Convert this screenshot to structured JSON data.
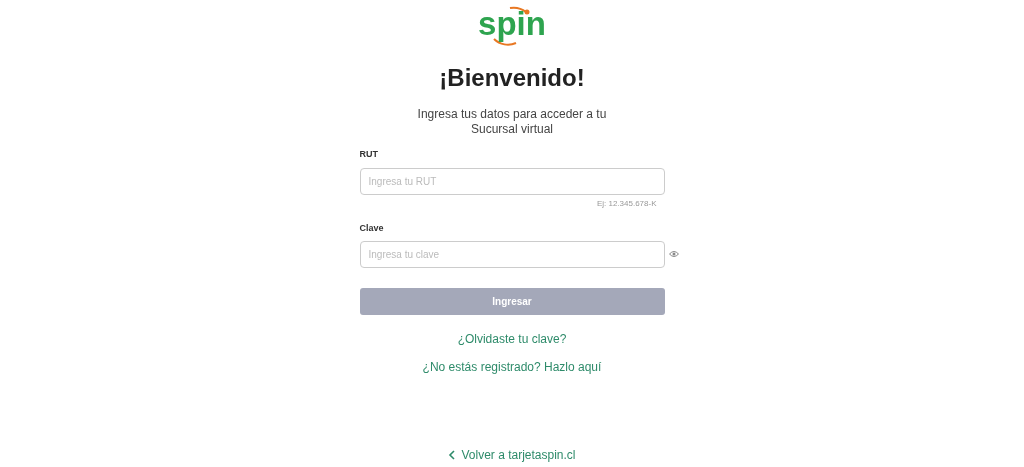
{
  "logo": {
    "text": "spin"
  },
  "title": "¡Bienvenido!",
  "subtitle": "Ingresa tus datos para acceder a tu Sucursal virtual",
  "fields": [
    {
      "label": "RUT",
      "placeholder": "Ingresa tu RUT",
      "hint": "Ej: 12.345.678-K",
      "kind": "text"
    },
    {
      "label": "Clave",
      "placeholder": "Ingresa tu clave",
      "kind": "password"
    }
  ],
  "submit": {
    "label": "Ingresar",
    "disabled": true
  },
  "links": [
    "¿Olvidaste tu clave?",
    "¿No estás registrado? Hazlo aquí"
  ],
  "back_link": "Volver a tarjetaspin.cl"
}
